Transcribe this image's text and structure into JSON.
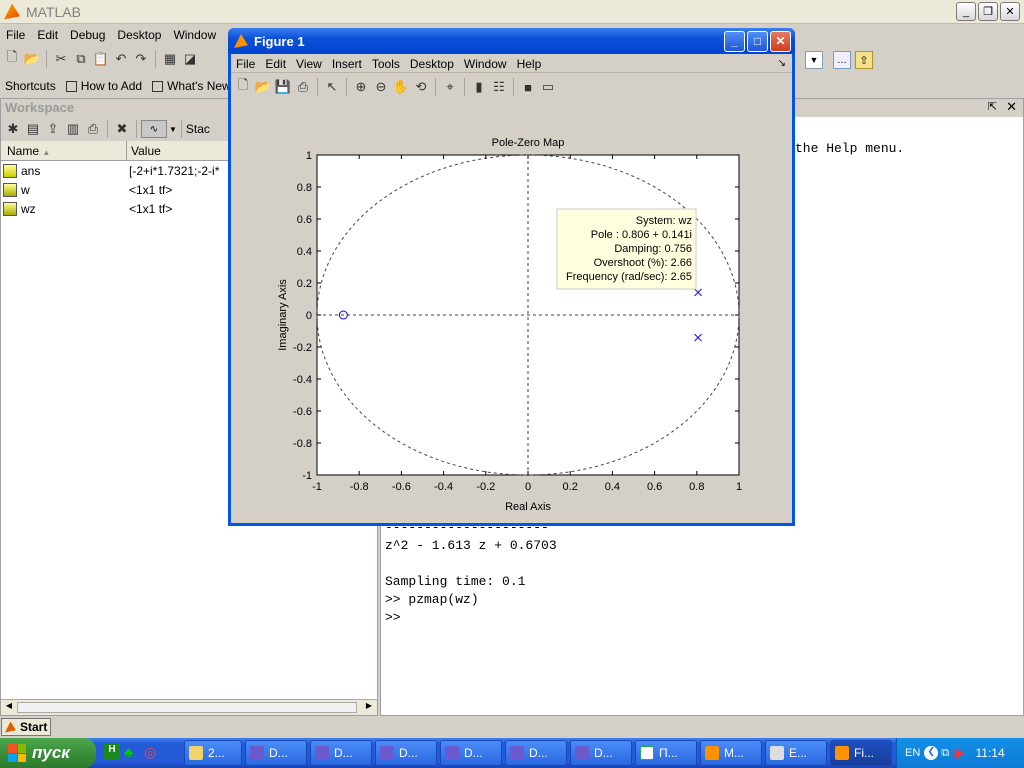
{
  "app": {
    "title": "MATLAB"
  },
  "menu": [
    "File",
    "Edit",
    "Debug",
    "Desktop",
    "Window",
    "Help"
  ],
  "menu_last_partial": "Help",
  "shortcuts": {
    "label": "Shortcuts",
    "how_to_add": "How to Add",
    "whats_new": "What's New"
  },
  "workspace": {
    "title": "Workspace",
    "stack_partial": "Stac",
    "col_name": "Name",
    "col_value": "Value",
    "rows": [
      {
        "name": "ans",
        "value": "[-2+i*1.7321;-2-i*"
      },
      {
        "name": "w",
        "value": "<1x1 tf>"
      },
      {
        "name": "wz",
        "value": "<1x1 tf>"
      }
    ]
  },
  "command": {
    "help_line": "the Help menu.",
    "dashes": "---------------------",
    "poly": "z^2 - 1.613 z + 0.6703",
    "sampling": "Sampling time: 0.1",
    "cmd": ">> pzmap(wz)",
    "prompt": ">>"
  },
  "start_button": "Start",
  "figure": {
    "title": "Figure 1",
    "menu": [
      "File",
      "Edit",
      "View",
      "Insert",
      "Tools",
      "Desktop",
      "Window",
      "Help"
    ]
  },
  "chart_data": {
    "type": "scatter",
    "title": "Pole-Zero Map",
    "xlabel": "Real Axis",
    "ylabel": "Imaginary Axis",
    "xlim": [
      -1,
      1
    ],
    "ylim": [
      -1,
      1
    ],
    "xticks": [
      "-1",
      "-0.8",
      "-0.6",
      "-0.4",
      "-0.2",
      "0",
      "0.2",
      "0.4",
      "0.6",
      "0.8",
      "1"
    ],
    "yticks": [
      "1",
      "0.8",
      "0.6",
      "0.4",
      "0.2",
      "0",
      "-0.2",
      "-0.4",
      "-0.6",
      "-0.8",
      "-1"
    ],
    "zeros": [
      {
        "x": -0.875,
        "y": 0
      }
    ],
    "poles": [
      {
        "x": 0.806,
        "y": 0.141
      },
      {
        "x": 0.806,
        "y": -0.141
      }
    ],
    "unit_circle": true,
    "datatip": {
      "line1": "System: wz",
      "line2": "Pole : 0.806 + 0.141i",
      "line3": "Damping: 0.756",
      "line4": "Overshoot (%): 2.66",
      "line5": "Frequency (rad/sec): 2.65"
    },
    "colors": {
      "poles": "#0000ff",
      "zeros": "#0000ff"
    }
  },
  "taskbar": {
    "start": "пуск",
    "lang": "EN",
    "clock": "11:14",
    "items": [
      "2...",
      "D...",
      "D...",
      "D...",
      "D...",
      "D...",
      "D...",
      "П...",
      "M...",
      "E...",
      "Fi..."
    ]
  }
}
